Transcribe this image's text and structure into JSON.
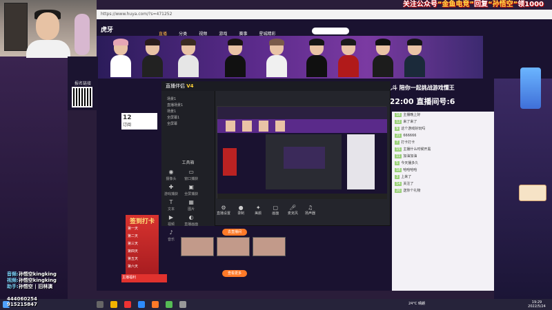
{
  "banner": {
    "prefix": "关注公众号",
    "k1": "“金鱼电竞”",
    "mid": "回复",
    "k2": "“孙悟空”",
    "suffix": "领1000"
  },
  "browser": {
    "address": "https://www.huya.com/?s=471252",
    "logo": "虎牙",
    "nav": [
      "直播",
      "分类",
      "视频",
      "游戏",
      "赛事",
      "星城精彩"
    ],
    "active_nav_index": 0
  },
  "qr": {
    "label": "报名链接"
  },
  "schedule": {
    "line1": "乱斗  陪你一起挑战游戏懂王",
    "line2": "-22:00  直播间号:6"
  },
  "obs": {
    "title": "直播伴侣",
    "badge": "V4",
    "scenes": [
      "场景1",
      "直播场景1",
      "场景1",
      "全屏幕1",
      "全屏幕"
    ],
    "tools_title": "工具箱",
    "tools": [
      "摄像头",
      "窗口捕获",
      "游戏捕获",
      "全屏捕获",
      "文本",
      "图片",
      "视频",
      "直播画面",
      "音乐",
      "连麦",
      "分屏",
      "更多"
    ],
    "bottom": [
      "直播设置",
      "录制",
      "美颜",
      "画面",
      "麦克风",
      "扬声器"
    ]
  },
  "cards": {
    "num": "12",
    "num_label": "订阅",
    "signin_title": "签到打卡",
    "signin_rows": [
      "第一天",
      "第二天",
      "第三天",
      "第四天",
      "第五天",
      "第六天"
    ],
    "redbar": "主播福利"
  },
  "thumbs": {
    "live_btn": "去直播间",
    "more_btn": "查看更多"
  },
  "chat": {
    "messages": [
      {
        "lvl": "18",
        "text": "主播晚上好"
      },
      {
        "lvl": "12",
        "text": "来了来了"
      },
      {
        "lvl": "9",
        "text": "这个游戏好玩吗"
      },
      {
        "lvl": "21",
        "text": "666666"
      },
      {
        "lvl": "7",
        "text": "打卡打卡"
      },
      {
        "lvl": "15",
        "text": "主播什么时候开黑"
      },
      {
        "lvl": "11",
        "text": "加油加油"
      },
      {
        "lvl": "5",
        "text": "今天播多久"
      },
      {
        "lvl": "18",
        "text": "哈哈哈哈"
      },
      {
        "lvl": "3",
        "text": "上来了"
      },
      {
        "lvl": "14",
        "text": "关注了"
      },
      {
        "lvl": "20",
        "text": "送你个礼物"
      }
    ]
  },
  "credits": [
    {
      "role": "音频:",
      "name": "孙悟空kingking"
    },
    {
      "role": "视频:",
      "name": "孙悟空kingking"
    },
    {
      "role": "助手:",
      "name": "孙悟空 | 旧林演"
    }
  ],
  "fans": {
    "l1": "444060254",
    "l2": "915215847"
  },
  "taskbar": {
    "weather": "24°C 晴朗",
    "time": "19:29",
    "date": "2022/5/24"
  },
  "colors": {
    "brand": "#ff7a28",
    "banner_text": "#ffe14a",
    "obs_bg": "#24252c"
  }
}
